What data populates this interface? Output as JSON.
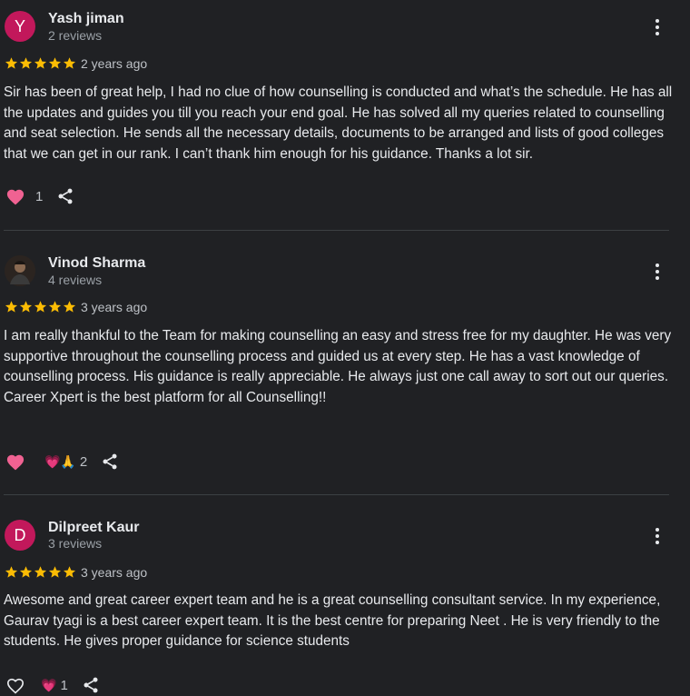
{
  "reviews": [
    {
      "initial": "Y",
      "avatar_color": "#c2185b",
      "name": "Yash jiman",
      "review_count": "2 reviews",
      "rating": 5,
      "date": "2 years ago",
      "text": "Sir has been of great help, I had no clue of how counselling is conducted and what’s the schedule. He has all the updates and guides you till you reach your end goal. He has solved all my queries related to counselling and seat selection. He sends all the necessary details, documents to be arranged and lists of good colleges that we can get in our rank. I can’t thank him enough for his guidance. Thanks a lot sir.",
      "reaction_count": "1"
    },
    {
      "name": "Vinod Sharma",
      "review_count": "4 reviews",
      "rating": 5,
      "date": "3 years ago",
      "text": "I am really thankful to the Team for making counselling an easy and stress free for my daughter. He was very supportive throughout the counselling process and guided us at every step. He has a vast knowledge of counselling process. His guidance is really appreciable. He always just one call away to sort out our queries.\nCareer Xpert is the best platform for all Counselling!!",
      "reaction_emojis": "💗🙏",
      "reaction_count": "2"
    },
    {
      "initial": "D",
      "avatar_color": "#c2185b",
      "name": "Dilpreet Kaur",
      "review_count": "3 reviews",
      "rating": 5,
      "date": "3 years ago",
      "text": "Awesome and great career expert team and he is a great counselling consultant service. In my experience, Gaurav tyagi is a best career expert team. It is the best centre for preparing Neet . He is very friendly to the students. He gives proper guidance for science students",
      "reaction_emojis": "💗",
      "reaction_count": "1"
    }
  ],
  "colors": {
    "star": "#fbbc04",
    "heart": "#f06292",
    "text": "#e8eaed",
    "muted": "#9aa0a6"
  },
  "icons": {
    "more": "more-vert-icon",
    "share": "share-icon",
    "heart": "heart-icon"
  }
}
